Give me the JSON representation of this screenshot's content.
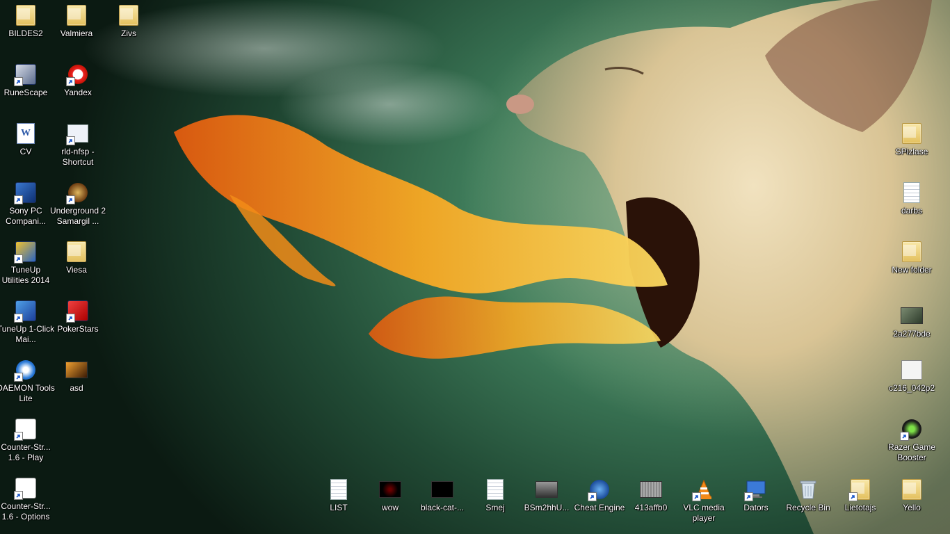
{
  "colors": {
    "accent_flame": "#f7a823",
    "background": "#2f6a4d"
  },
  "icons": {
    "bildes2": {
      "label": "BILDES2",
      "glyph": "folder-icon"
    },
    "valmiera": {
      "label": "Valmiera",
      "glyph": "folder-icon"
    },
    "zivs": {
      "label": "Zivs",
      "glyph": "folder-icon"
    },
    "runescape": {
      "label": "RuneScape",
      "glyph": "runescape-icon"
    },
    "yandex": {
      "label": "Yandex",
      "glyph": "yandex-icon"
    },
    "cv": {
      "label": "CV",
      "glyph": "word-document-icon"
    },
    "rld_nfsp": {
      "label": "rld-nfsp - Shortcut",
      "glyph": "window-icon"
    },
    "sony_pc": {
      "label": "Sony PC Compani...",
      "glyph": "sony-pc-icon"
    },
    "underground": {
      "label": "Underground 2 Samargil ...",
      "glyph": "game-icon"
    },
    "tuneup_2014": {
      "label": "TuneUp Utilities 2014",
      "glyph": "tuneup-icon"
    },
    "viesa": {
      "label": "Viesa",
      "glyph": "folder-icon"
    },
    "tuneup_1click": {
      "label": "TuneUp 1-Click Mai...",
      "glyph": "tuneup-icon"
    },
    "pokerstars": {
      "label": "PokerStars",
      "glyph": "pokerstars-icon"
    },
    "daemon": {
      "label": "DAEMON Tools Lite",
      "glyph": "daemon-tools-icon"
    },
    "asd": {
      "label": "asd",
      "glyph": "image-icon"
    },
    "cs_play": {
      "label": "Counter-Str... 1.6 - Play",
      "glyph": "counter-strike-icon"
    },
    "cs_options": {
      "label": "Counter-Str... 1.6 - Options",
      "glyph": "counter-strike-icon"
    },
    "list": {
      "label": "LIST",
      "glyph": "text-document-icon"
    },
    "wow": {
      "label": "wow",
      "glyph": "image-icon"
    },
    "black_cat": {
      "label": "black-cat-...",
      "glyph": "image-icon"
    },
    "smej": {
      "label": "Smej",
      "glyph": "text-document-icon"
    },
    "bsm2hhu": {
      "label": "BSm2hhU...",
      "glyph": "image-icon"
    },
    "cheat_engine": {
      "label": "Cheat Engine",
      "glyph": "cheat-engine-icon"
    },
    "413affb0": {
      "label": "413affb0",
      "glyph": "image-icon"
    },
    "vlc": {
      "label": "VLC media player",
      "glyph": "vlc-icon"
    },
    "dators": {
      "label": "Dators",
      "glyph": "computer-icon"
    },
    "recycle_bin": {
      "label": "Recycle Bin",
      "glyph": "recycle-bin-icon"
    },
    "lietotajs": {
      "label": "Lietotajs",
      "glyph": "user-folder-icon"
    },
    "yello": {
      "label": "Yello",
      "glyph": "folder-icon"
    },
    "spizlase": {
      "label": "SPizlase",
      "glyph": "folder-icon"
    },
    "darbs": {
      "label": "darbs",
      "glyph": "text-document-icon"
    },
    "new_folder": {
      "label": "New folder",
      "glyph": "folder-icon"
    },
    "2a277bde": {
      "label": "2a277bde",
      "glyph": "image-icon"
    },
    "c216_042p2": {
      "label": "c216_042p2",
      "glyph": "image-icon"
    },
    "razer": {
      "label": "Razer Game Booster",
      "glyph": "razer-icon"
    }
  }
}
